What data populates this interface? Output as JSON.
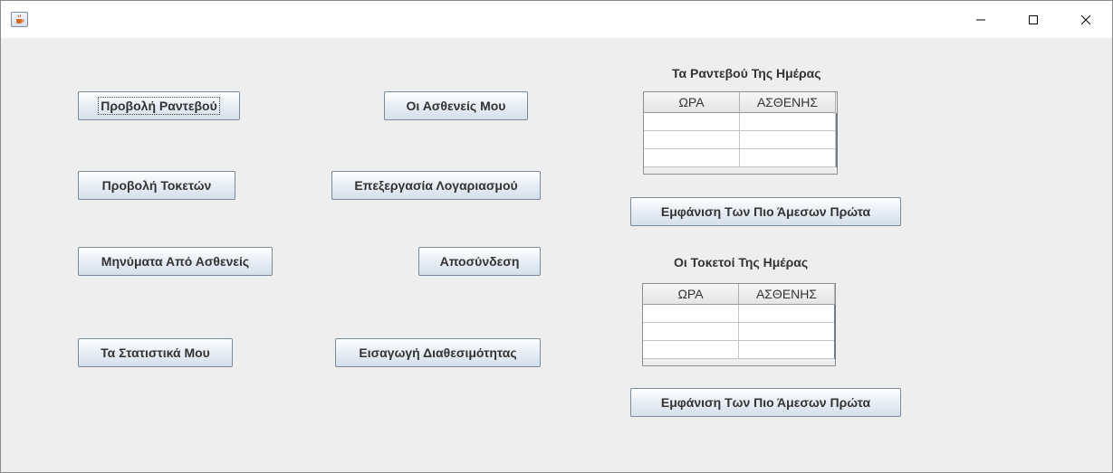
{
  "window": {
    "title": "",
    "controls": {
      "minimize": "minimize",
      "maximize": "maximize",
      "close": "close"
    }
  },
  "left_buttons": {
    "view_appointments": "Προβολή Ραντεβού",
    "view_births": "Προβολή Τοκετών",
    "patient_messages": "Μηνύματα Από Ασθενείς",
    "my_statistics": "Τα Στατιστικά Μου"
  },
  "middle_buttons": {
    "my_patients": "Οι Ασθενείς Μου",
    "edit_account": "Επεξεργασία Λογαριασμού",
    "logout": "Αποσύνδεση",
    "enter_availability": "Εισαγωγή Διαθεσιμότητας"
  },
  "appointments_panel": {
    "title": "Τα Ραντεβού Της Ημέρας",
    "columns": [
      "ΩΡΑ",
      "ΑΣΘΕΝΗΣ"
    ],
    "rows": [
      [
        "",
        ""
      ],
      [
        "",
        ""
      ],
      [
        "",
        ""
      ]
    ],
    "sort_button": "Εμφάνιση Των Πιο Άμεσων Πρώτα"
  },
  "births_panel": {
    "title": "Οι Τοκετοί Της Ημέρας",
    "columns": [
      "ΩΡΑ",
      "ΑΣΘΕΝΗΣ"
    ],
    "rows": [
      [
        "",
        ""
      ],
      [
        "",
        ""
      ],
      [
        "",
        ""
      ]
    ],
    "sort_button": "Εμφάνιση Των Πιο Άμεσων Πρώτα"
  },
  "icons": {
    "app": "java-coffee-cup-icon",
    "minimize": "minimize-icon",
    "maximize": "maximize-icon",
    "close": "close-icon"
  },
  "colors": {
    "background": "#eeeeee",
    "button_border": "#7a8a99",
    "text": "#333333"
  }
}
